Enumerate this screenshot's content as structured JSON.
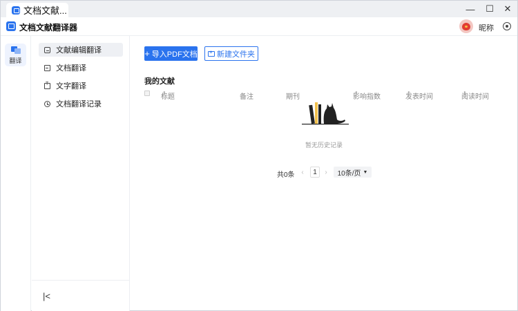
{
  "tab": {
    "title": "文档文献..."
  },
  "window_controls": {
    "minimize": "—",
    "maximize": "☐",
    "close": "✕"
  },
  "app": {
    "title": "文档文献翻译器"
  },
  "user": {
    "nickname": "昵称"
  },
  "rail": {
    "label": "翻译"
  },
  "sidebar": {
    "items": [
      {
        "label": "文献编辑翻译",
        "icon": "edit-icon",
        "active": true
      },
      {
        "label": "文档翻译",
        "icon": "document-icon",
        "active": false
      },
      {
        "label": "文字翻译",
        "icon": "text-icon",
        "active": false
      },
      {
        "label": "文档翻译记录",
        "icon": "clock-icon",
        "active": false
      }
    ],
    "collapse_glyph": "|<"
  },
  "toolbar": {
    "import_label": "导入PDF文档",
    "new_folder_label": "新建文件夹"
  },
  "section": {
    "title": "我的文献"
  },
  "table": {
    "columns": [
      "标题",
      "备注",
      "期刊",
      "影响指数",
      "发表时间",
      "阅读时间"
    ],
    "sort_glyph": "⬍"
  },
  "empty": {
    "text": "暂无历史记录"
  },
  "pagination": {
    "total": "共0条",
    "prev": "‹",
    "page": "1",
    "next": "›",
    "page_size": "10条/页"
  },
  "colors": {
    "accent": "#2a73ee",
    "avatar": "#e23c32"
  }
}
